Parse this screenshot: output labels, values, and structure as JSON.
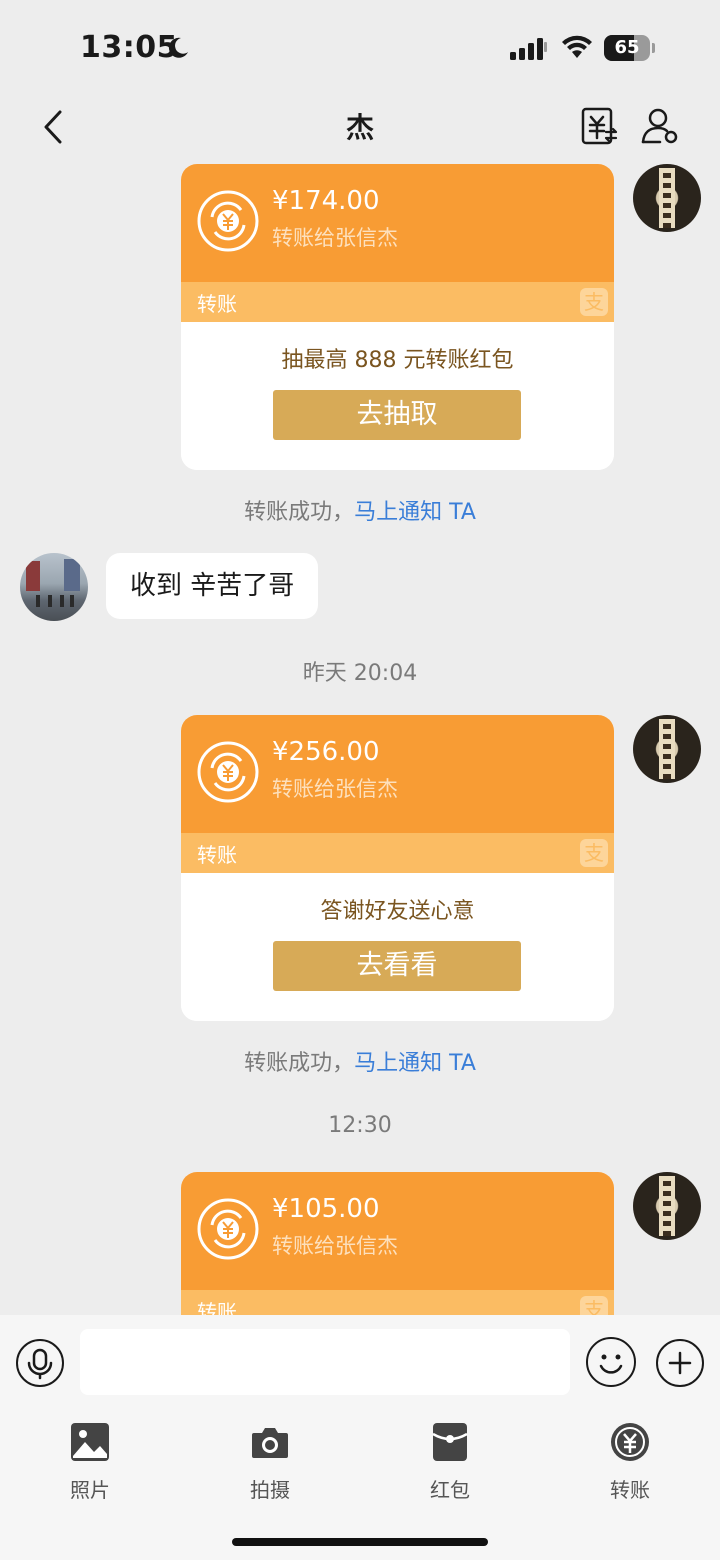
{
  "status_bar": {
    "time": "13:05",
    "battery": "65",
    "battery_percent": 65
  },
  "nav": {
    "title": "杰"
  },
  "messages": {
    "transfer1": {
      "amount": "¥174.00",
      "to": "转账给张信杰",
      "label": "转账",
      "promo": "抽最高 888 元转账红包",
      "button": "去抽取"
    },
    "sys1": {
      "text": "转账成功，",
      "link": "马上通知 TA"
    },
    "friend_msg": {
      "text": "收到 辛苦了哥"
    },
    "time1": "昨天 20:04",
    "transfer2": {
      "amount": "¥256.00",
      "to": "转账给张信杰",
      "label": "转账",
      "promo": "答谢好友送心意",
      "button": "去看看"
    },
    "sys2": {
      "text": "转账成功，",
      "link": "马上通知 TA"
    },
    "time2": "12:30",
    "transfer3": {
      "amount": "¥105.00",
      "to": "转账给张信杰",
      "label": "转账"
    }
  },
  "input": {
    "value": "",
    "placeholder": ""
  },
  "tools": [
    {
      "label": "照片",
      "icon": "photo-icon"
    },
    {
      "label": "拍摄",
      "icon": "camera-icon"
    },
    {
      "label": "红包",
      "icon": "red-packet-icon"
    },
    {
      "label": "转账",
      "icon": "transfer-icon"
    }
  ],
  "colors": {
    "card_orange": "#f89c34",
    "card_strip": "#fbbc63",
    "button_gold": "#d7aa57",
    "link_blue": "#3a7ed8"
  }
}
